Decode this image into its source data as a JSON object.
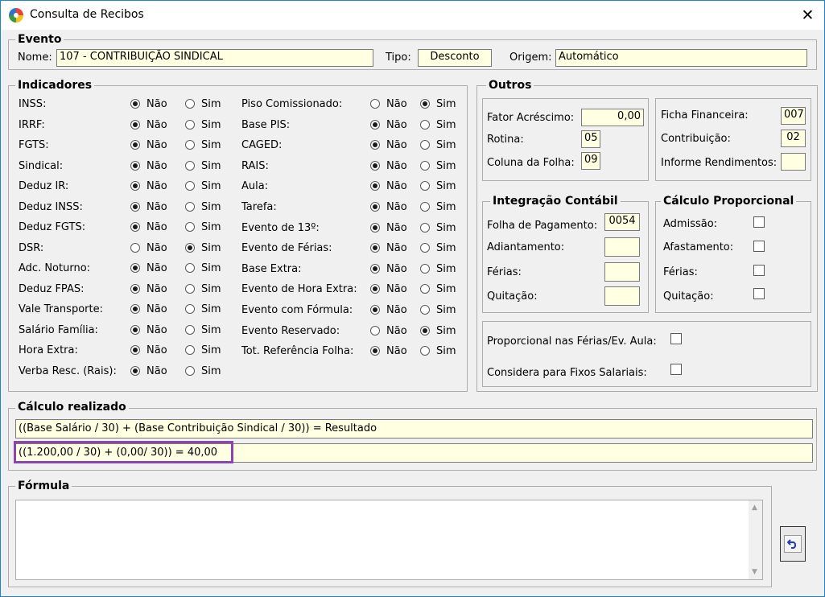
{
  "window": {
    "title": "Consulta de Recibos",
    "close_label": "✕"
  },
  "evento": {
    "group_title": "Evento",
    "nome_label": "Nome:",
    "nome_value": "107 - CONTRIBUIÇÃO SINDICAL",
    "tipo_label": "Tipo:",
    "tipo_value": "Desconto",
    "origem_label": "Origem:",
    "origem_value": "Automático"
  },
  "indicadores": {
    "group_title": "Indicadores",
    "nao": "Não",
    "sim": "Sim",
    "left": [
      {
        "label": "INSS:",
        "value": "Não"
      },
      {
        "label": "IRRF:",
        "value": "Não"
      },
      {
        "label": "FGTS:",
        "value": "Não"
      },
      {
        "label": "Sindical:",
        "value": "Não"
      },
      {
        "label": "Deduz IR:",
        "value": "Não"
      },
      {
        "label": "Deduz INSS:",
        "value": "Não"
      },
      {
        "label": "Deduz FGTS:",
        "value": "Não"
      },
      {
        "label": "DSR:",
        "value": "Sim"
      },
      {
        "label": "Adc. Noturno:",
        "value": "Não"
      },
      {
        "label": "Deduz FPAS:",
        "value": "Não"
      },
      {
        "label": "Vale Transporte:",
        "value": "Não"
      },
      {
        "label": "Salário Família:",
        "value": "Não"
      },
      {
        "label": "Hora Extra:",
        "value": "Não"
      },
      {
        "label": "Verba Resc. (Rais):",
        "value": "Não"
      }
    ],
    "right": [
      {
        "label": "Piso Comissionado:",
        "value": "Sim"
      },
      {
        "label": "Base PIS:",
        "value": "Não"
      },
      {
        "label": "CAGED:",
        "value": "Não"
      },
      {
        "label": "RAIS:",
        "value": "Não"
      },
      {
        "label": "Aula:",
        "value": "Não"
      },
      {
        "label": "Tarefa:",
        "value": "Não"
      },
      {
        "label": "Evento de 13º:",
        "value": "Não"
      },
      {
        "label": "Evento de Férias:",
        "value": "Não"
      },
      {
        "label": "Base Extra:",
        "value": "Não"
      },
      {
        "label": "Evento de Hora Extra:",
        "value": "Não"
      },
      {
        "label": "Evento com Fórmula:",
        "value": "Não"
      },
      {
        "label": "Evento Reservado:",
        "value": "Sim"
      },
      {
        "label": "Tot. Referência Folha:",
        "value": "Não"
      }
    ]
  },
  "outros": {
    "group_title": "Outros",
    "fator_label": "Fator Acréscimo:",
    "fator_value": "0,00",
    "rotina_label": "Rotina:",
    "rotina_value": "05",
    "coluna_label": "Coluna da Folha:",
    "coluna_value": "09",
    "ficha_label": "Ficha Financeira:",
    "ficha_value": "007",
    "contrib_label": "Contribuição:",
    "contrib_value": "02",
    "informe_label": "Informe Rendimentos:",
    "informe_value": ""
  },
  "integracao": {
    "group_title": "Integração Contábil",
    "folha_label": "Folha de Pagamento:",
    "folha_value": "0054",
    "adiant_label": "Adiantamento:",
    "adiant_value": "",
    "ferias_label": "Férias:",
    "ferias_value": "",
    "quit_label": "Quitação:",
    "quit_value": ""
  },
  "proporcional": {
    "group_title": "Cálculo Proporcional",
    "admissao_label": "Admissão:",
    "afastamento_label": "Afastamento:",
    "ferias_label": "Férias:",
    "quitacao_label": "Quitação:"
  },
  "extras": {
    "prop_ferias_label": "Proporcional nas Férias/Ev. Aula:",
    "fixos_label": "Considera para Fixos Salariais:"
  },
  "calculo": {
    "group_title": "Cálculo realizado",
    "formula_text": "((Base Salário / 30) + (Base Contribuição Sindical / 30)) = Resultado",
    "result_text": "((1.200,00 / 30) + (0,00/ 30)) = 40,00"
  },
  "formula": {
    "group_title": "Fórmula",
    "content": ""
  },
  "colors": {
    "input_bg": "#ffffe1",
    "highlight": "#8e44ad",
    "title_border": "#1883d7"
  },
  "icons": {
    "undo": "undo-icon",
    "app": "app-icon",
    "close": "close-icon"
  }
}
